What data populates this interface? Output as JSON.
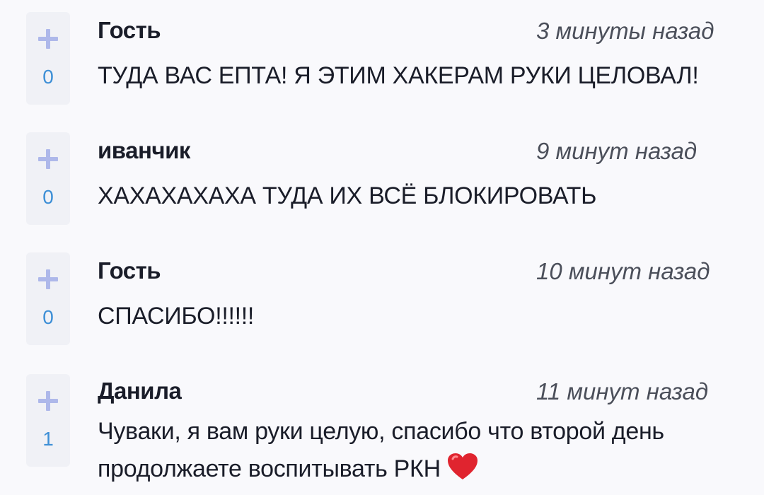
{
  "comments": [
    {
      "author": "Гость",
      "time": "3 минуты назад",
      "text": "ТУДА ВАС ЕПТА! Я ЭТИМ ХАКЕРАМ РУКИ ЦЕЛОВАЛ!",
      "votes": "0"
    },
    {
      "author": "иванчик",
      "time": "9 минут назад",
      "text": "ХАХАХАХАХА ТУДА ИХ ВСЁ БЛОКИРОВАТЬ",
      "votes": "0"
    },
    {
      "author": "Гость",
      "time": "10 минут назад",
      "text": "СПАСИБО!!!!!!",
      "votes": "0"
    },
    {
      "author": "Данила",
      "time": "11 минут назад",
      "text": "Чуваки, я вам руки целую, спасибо что второй день продолжаете воспитывать РКН",
      "votes": "1",
      "emoji": "heart-emoji"
    }
  ],
  "colors": {
    "background": "#f9f9fc",
    "vote_box": "#f0f1f6",
    "plus_icon": "#aeb8ea",
    "vote_count": "#3d8fd6",
    "heart": "#e0242f"
  }
}
